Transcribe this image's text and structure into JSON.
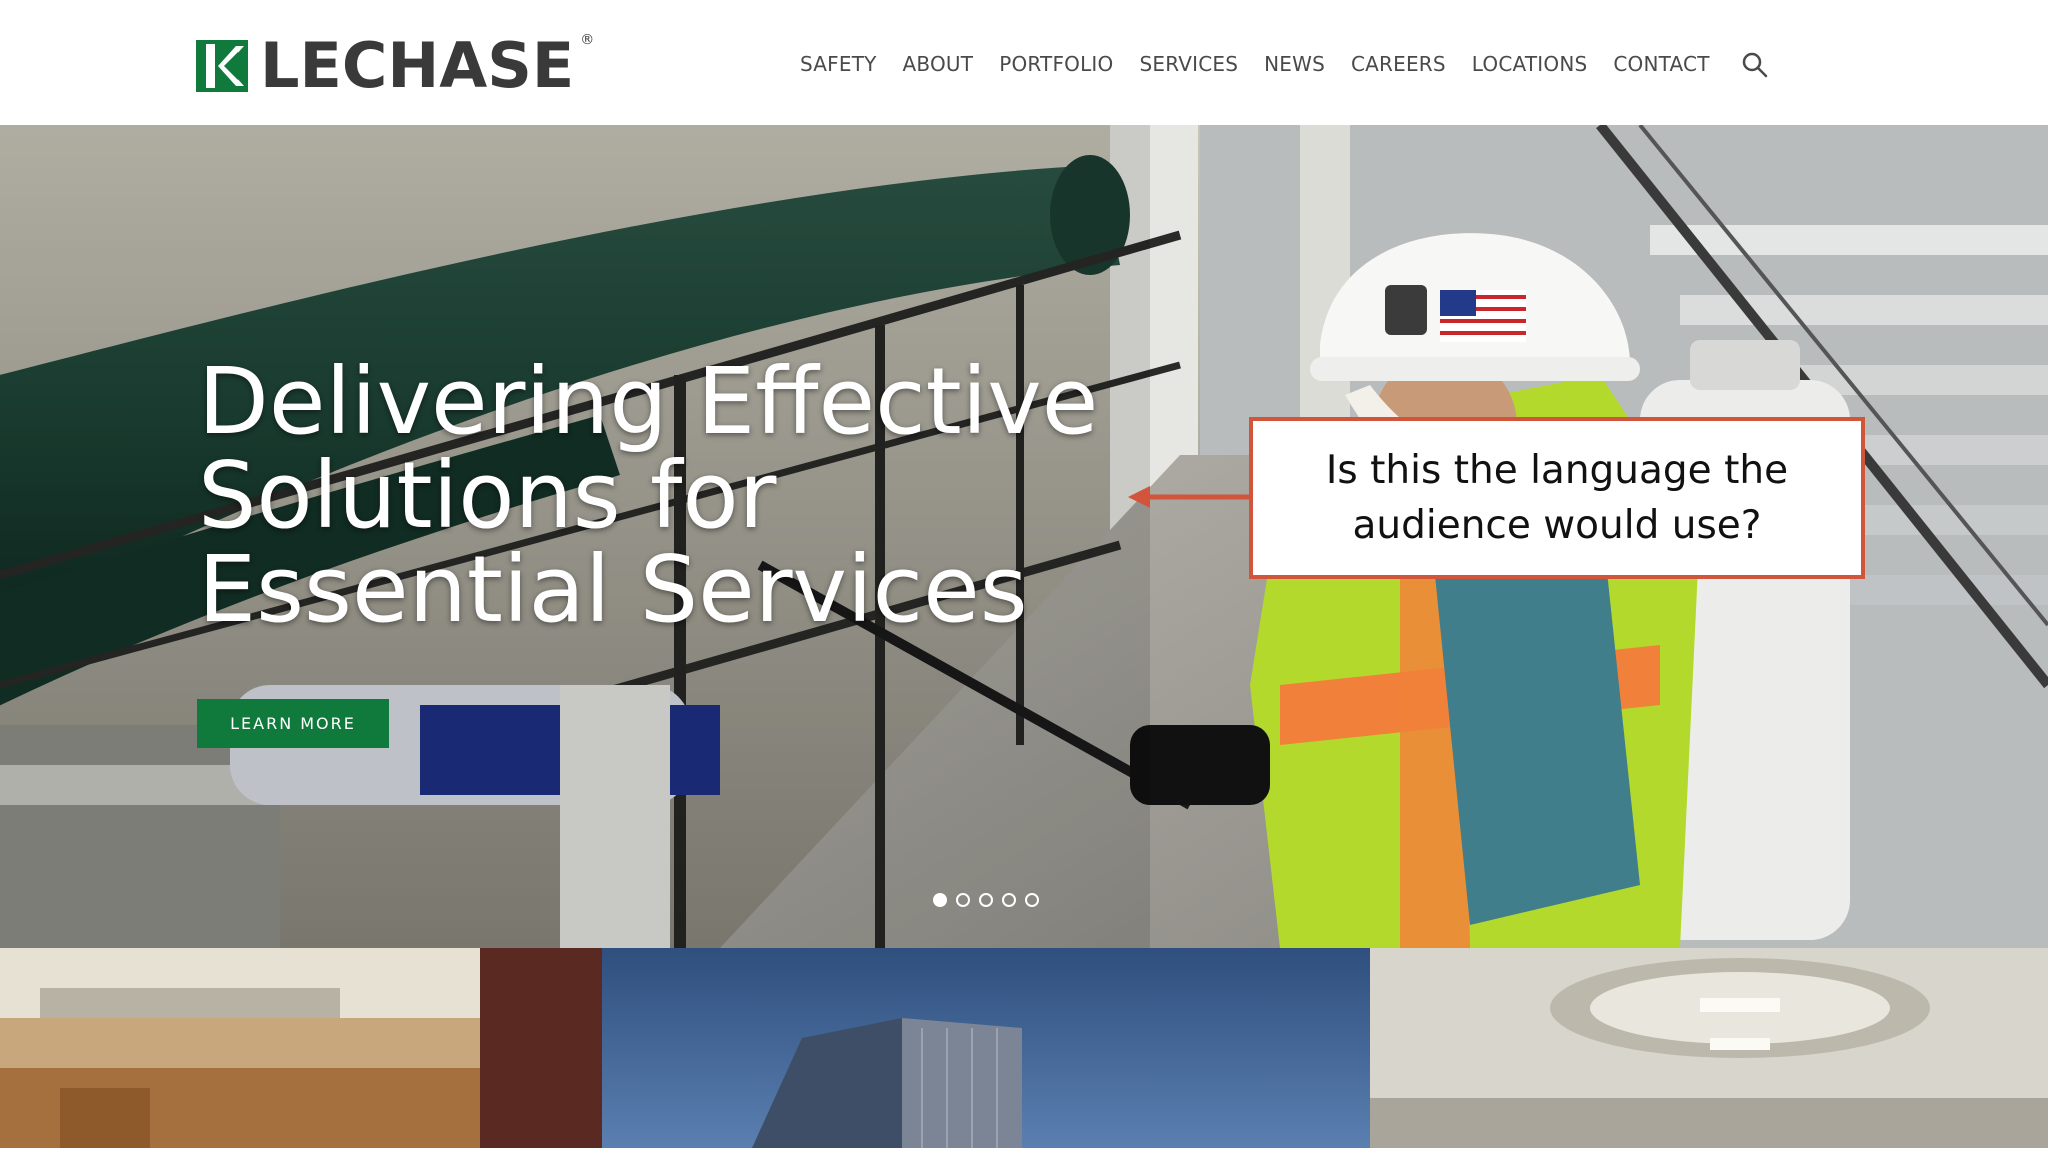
{
  "header": {
    "logo": {
      "text": "LECHASE",
      "trademark": "®",
      "brand_color": "#0f7a3c"
    },
    "nav": [
      "SAFETY",
      "ABOUT",
      "PORTFOLIO",
      "SERVICES",
      "NEWS",
      "CAREERS",
      "LOCATIONS",
      "CONTACT"
    ],
    "search_icon": "search-icon"
  },
  "hero": {
    "headline_lines": [
      "Delivering Effective",
      "Solutions for",
      "Essential Services"
    ],
    "cta_label": "LEARN MORE",
    "cta_color": "#0f7a3c",
    "slides_total": 5,
    "active_slide": 1
  },
  "callout": {
    "lines": [
      "Is this the language the",
      "audience would use?"
    ],
    "border_color": "#d1553a"
  }
}
